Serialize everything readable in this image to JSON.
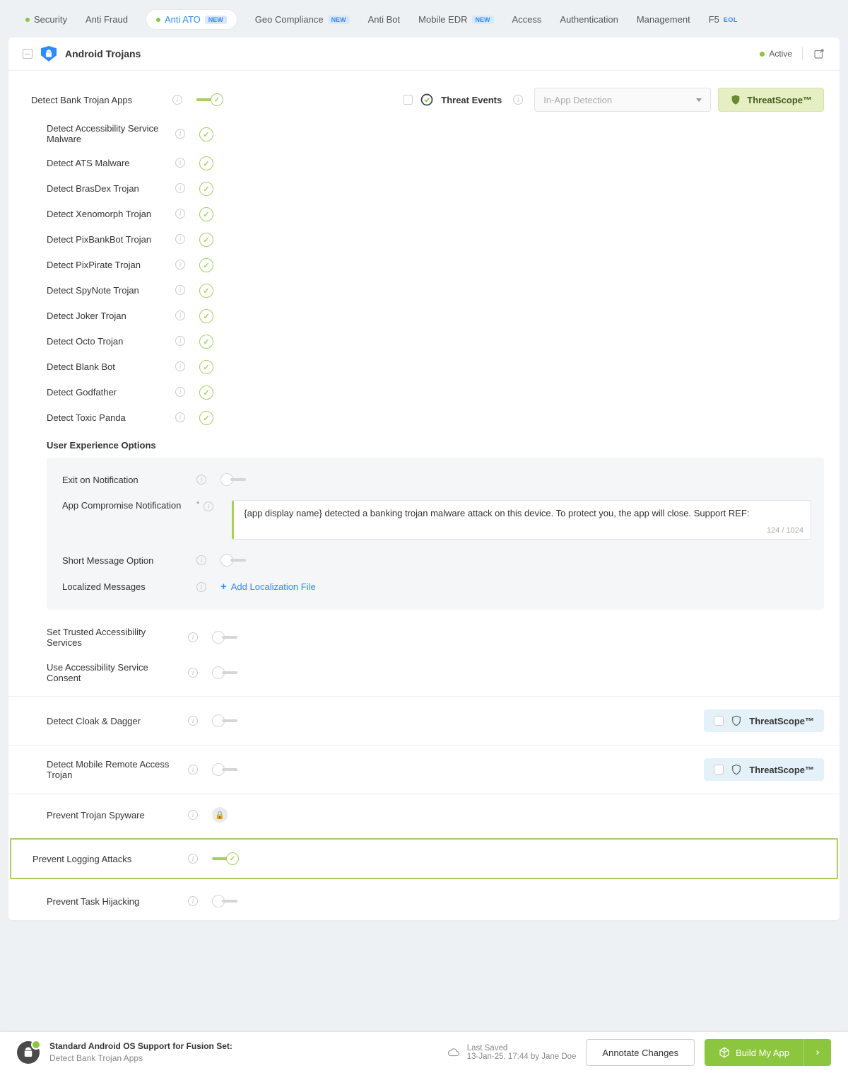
{
  "tabs": {
    "security": "Security",
    "antiFraud": "Anti Fraud",
    "antiATO": "Anti ATO",
    "geo": "Geo Compliance",
    "antiBot": "Anti Bot",
    "mobileEDR": "Mobile EDR",
    "access": "Access",
    "auth": "Authentication",
    "mgmt": "Management",
    "f5": "F5",
    "badgeNew": "NEW",
    "badgeEOL": "EOL"
  },
  "header": {
    "title": "Android Trojans",
    "status": "Active"
  },
  "topRow": {
    "label": "Detect Bank Trojan Apps",
    "threatEvents": "Threat Events",
    "selectPlaceholder": "In-App Detection",
    "threatScope": "ThreatScope™"
  },
  "subPolicies": {
    "p0": "Detect Accessibility Service Malware",
    "p1": "Detect ATS Malware",
    "p2": "Detect BrasDex Trojan",
    "p3": "Detect Xenomorph Trojan",
    "p4": "Detect PixBankBot Trojan",
    "p5": "Detect PixPirate Trojan",
    "p6": "Detect SpyNote Trojan",
    "p7": "Detect Joker Trojan",
    "p8": "Detect Octo Trojan",
    "p9": "Detect Blank Bot",
    "p10": "Detect Godfather",
    "p11": "Detect Toxic Panda"
  },
  "ux": {
    "heading": "User Experience Options",
    "exitOnNotification": "Exit on Notification",
    "appCompromise": "App Compromise Notification",
    "message": "{app display name} detected a banking trojan malware attack on this device. To protect you, the app will close. Support REF:",
    "counter": "124 / 1024",
    "shortMessage": "Short Message Option",
    "localized": "Localized Messages",
    "addLocalization": "Add Localization File"
  },
  "below": {
    "trusted": "Set Trusted Accessibility Services",
    "consent": "Use Accessibility Service Consent"
  },
  "sections": {
    "cloak": "Detect Cloak & Dagger",
    "mrat": "Detect Mobile Remote Access Trojan",
    "spyware": "Prevent Trojan Spyware",
    "logging": "Prevent Logging Attacks",
    "hijack": "Prevent Task Hijacking",
    "threatScope": "ThreatScope™"
  },
  "footer": {
    "line1": "Standard Android OS Support for Fusion Set:",
    "line2": "Detect Bank Trojan Apps",
    "lastSavedLabel": "Last Saved",
    "lastSavedValue": "13-Jan-25, 17:44 by Jane Doe",
    "annotate": "Annotate Changes",
    "build": "Build My App"
  }
}
